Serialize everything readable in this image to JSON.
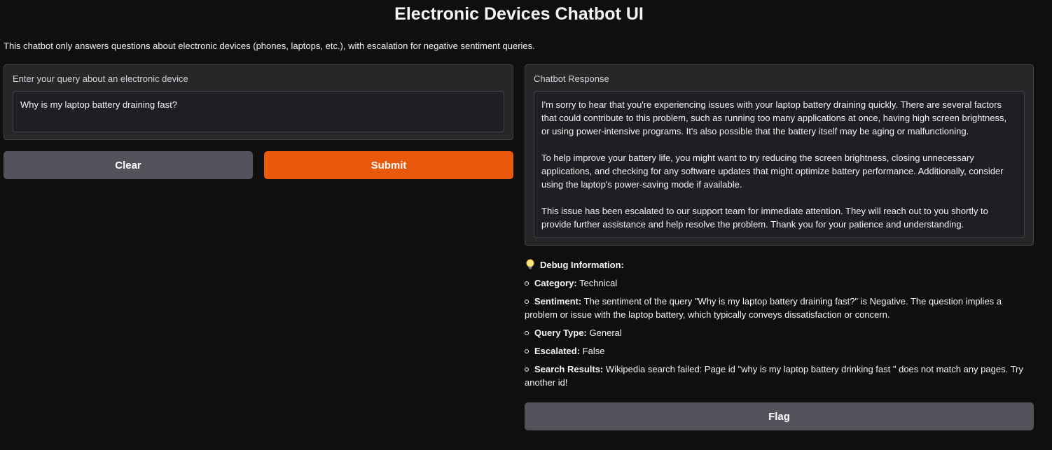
{
  "app": {
    "title": "Electronic Devices Chatbot UI",
    "description": "This chatbot only answers questions about electronic devices (phones, laptops, etc.), with escalation for negative sentiment queries."
  },
  "query": {
    "label": "Enter your query about an electronic device",
    "value": "Why is my laptop battery draining fast?"
  },
  "buttons": {
    "clear": "Clear",
    "submit": "Submit",
    "flag": "Flag"
  },
  "response": {
    "label": "Chatbot Response",
    "paragraphs": [
      "I'm sorry to hear that you're experiencing issues with your laptop battery draining quickly. There are several factors that could contribute to this problem, such as running too many applications at once, having high screen brightness, or using power-intensive programs. It's also possible that the battery itself may be aging or malfunctioning.",
      "To help improve your battery life, you might want to try reducing the screen brightness, closing unnecessary applications, and checking for any software updates that might optimize battery performance. Additionally, consider using the laptop's power-saving mode if available.",
      "This issue has been escalated to our support team for immediate attention. They will reach out to you shortly to provide further assistance and help resolve the problem. Thank you for your patience and understanding."
    ]
  },
  "debug": {
    "icon": "lightbulb-icon",
    "heading": "Debug Information:",
    "items": [
      {
        "key": "Category:",
        "value": "Technical"
      },
      {
        "key": "Sentiment:",
        "value": "The sentiment of the query \"Why is my laptop battery draining fast?\" is Negative. The question implies a problem or issue with the laptop battery, which typically conveys dissatisfaction or concern."
      },
      {
        "key": "Query Type:",
        "value": "General"
      },
      {
        "key": "Escalated:",
        "value": "False"
      },
      {
        "key": "Search Results:",
        "value": "Wikipedia search failed: Page id \"why is my laptop battery drinking fast \" does not match any pages. Try another id!"
      }
    ]
  },
  "colors": {
    "background": "#0f0f10",
    "panel": "#27272a",
    "primary": "#ea580c",
    "secondary": "#52525b"
  }
}
